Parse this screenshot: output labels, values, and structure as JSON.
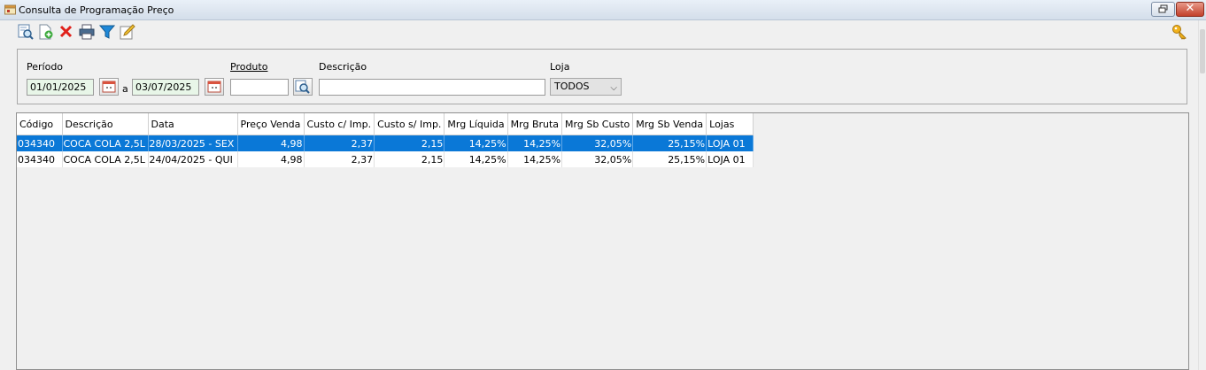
{
  "window": {
    "title": "Consulta de Programação Preço"
  },
  "toolbar": {
    "buttons": [
      {
        "name": "search-icon"
      },
      {
        "name": "new-document-icon"
      },
      {
        "name": "delete-icon"
      },
      {
        "name": "print-icon"
      },
      {
        "name": "filter-icon"
      },
      {
        "name": "edit-icon"
      }
    ],
    "key_icon": "key-icon"
  },
  "filters": {
    "periodo_label": "Período",
    "date_from": "01/01/2025",
    "a_label": "a",
    "date_to": "03/07/2025",
    "produto_label": "Produto",
    "produto_value": "",
    "descricao_label": "Descrição",
    "descricao_value": "",
    "loja_label": "Loja",
    "loja_value": "TODOS"
  },
  "grid": {
    "columns": [
      "Código",
      "Descrição",
      "Data",
      "Preço Venda",
      "Custo c/ Imp.",
      "Custo s/ Imp.",
      "Mrg Líquida",
      "Mrg Bruta",
      "Mrg Sb Custo",
      "Mrg Sb Venda",
      "Lojas"
    ],
    "rows": [
      [
        "034340",
        "COCA COLA 2,5L",
        "28/03/2025 - SEX",
        "4,98",
        "2,37",
        "2,15",
        "14,25%",
        "14,25%",
        "32,05%",
        "25,15%",
        "LOJA 01"
      ],
      [
        "034340",
        "COCA COLA 2,5L",
        "24/04/2025 - QUI",
        "4,98",
        "2,37",
        "2,15",
        "14,25%",
        "14,25%",
        "32,05%",
        "25,15%",
        "LOJA 01"
      ]
    ],
    "selected_row": 0
  },
  "colors": {
    "selection": "#0a78d7",
    "date_field_bg": "#e8f6e8",
    "title_bar": "#dfe7f1"
  }
}
